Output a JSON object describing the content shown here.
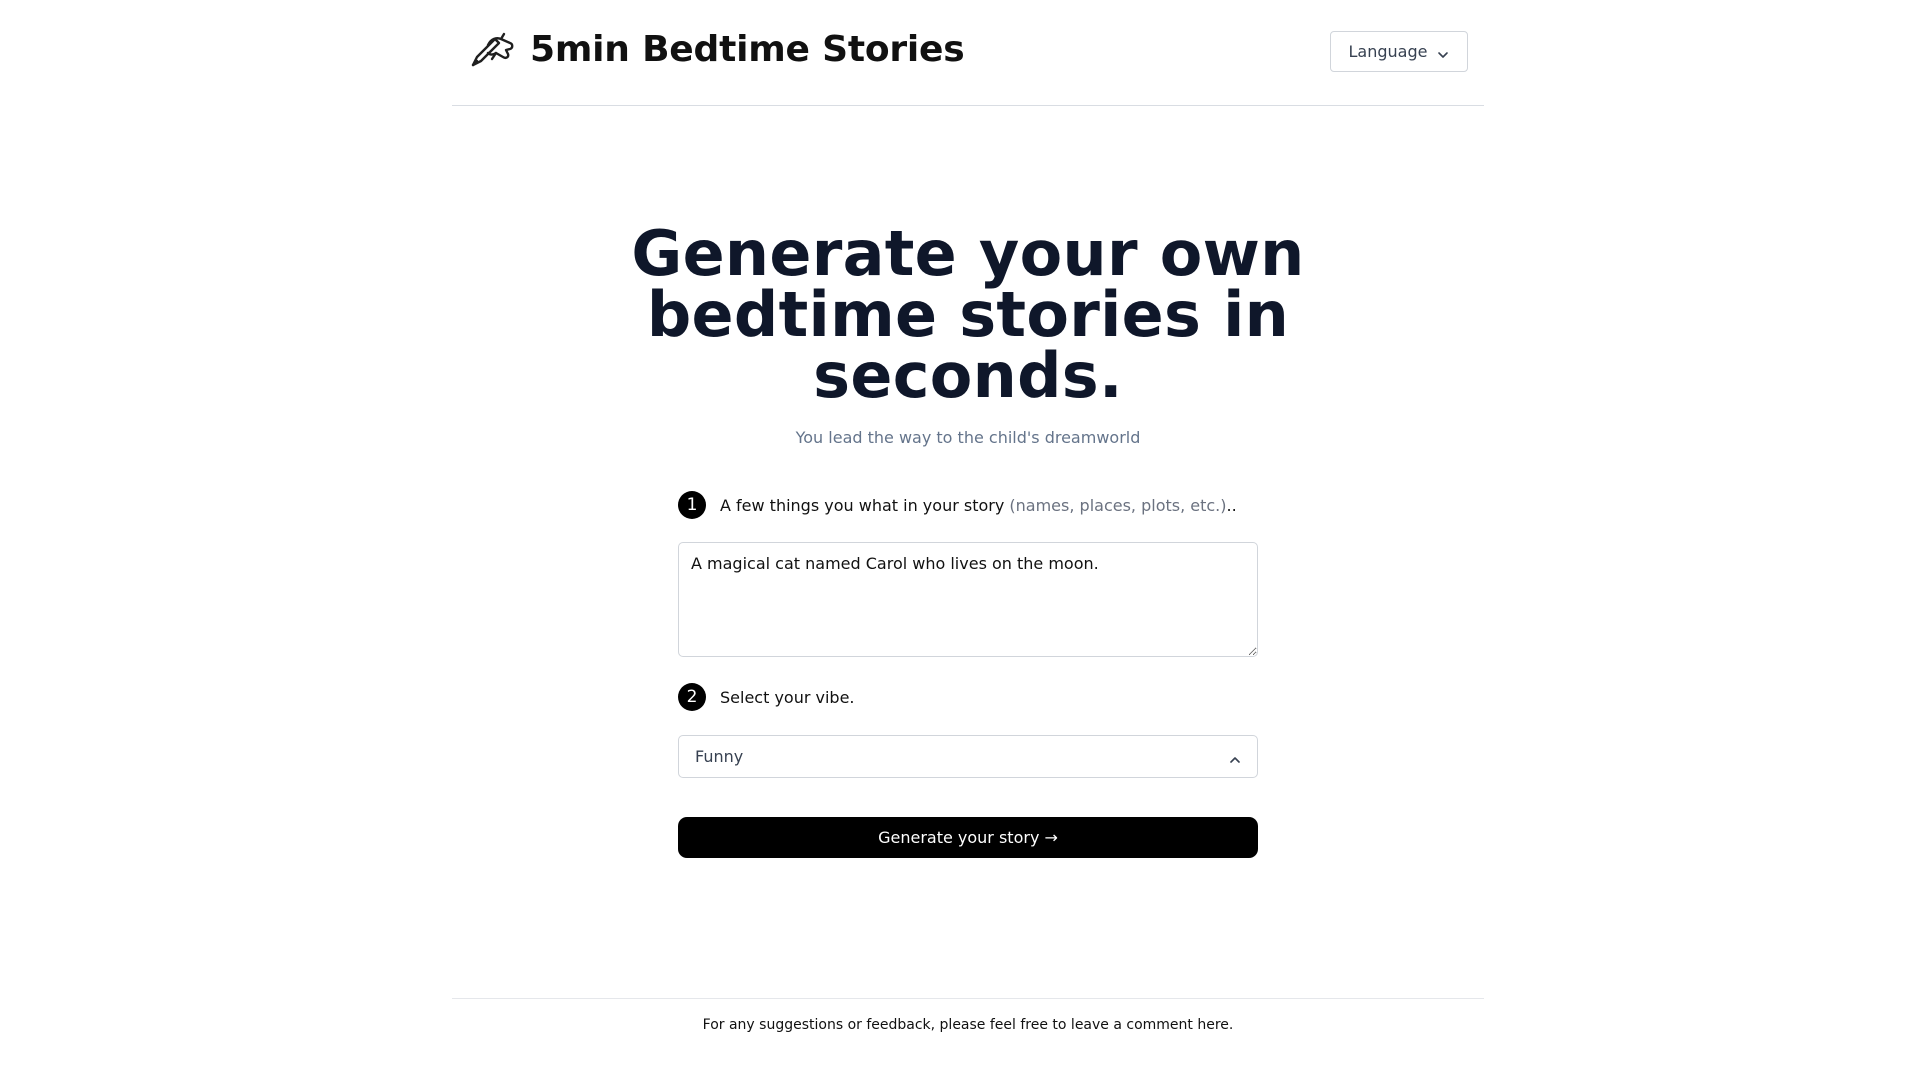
{
  "header": {
    "brand_title": "5min Bedtime Stories",
    "brand_icon": "writing-hand-icon",
    "language_label": "Language",
    "language_icon": "chevron-down-icon"
  },
  "hero": {
    "title_line1": "Generate your own",
    "title_line2": "bedtime stories in",
    "title_line3": "seconds.",
    "subtitle": "You lead the way to the child's dreamworld"
  },
  "form": {
    "step1": {
      "number": "1",
      "label": "A few things you what in your story",
      "hint": "(names, places, plots, etc.)",
      "suffix": ".",
      "input_value": "A magical cat named Carol who lives on the moon."
    },
    "step2": {
      "number": "2",
      "label": "Select your vibe.",
      "selected_vibe": "Funny",
      "select_icon": "chevron-up-icon"
    },
    "generate_label": "Generate your story →"
  },
  "footer": {
    "text": "For any suggestions or feedback, please feel free to leave a comment here."
  },
  "colors": {
    "text_primary": "#0f172a",
    "text_muted": "#64748b",
    "button_bg": "#000000",
    "border": "#d1d5db"
  }
}
